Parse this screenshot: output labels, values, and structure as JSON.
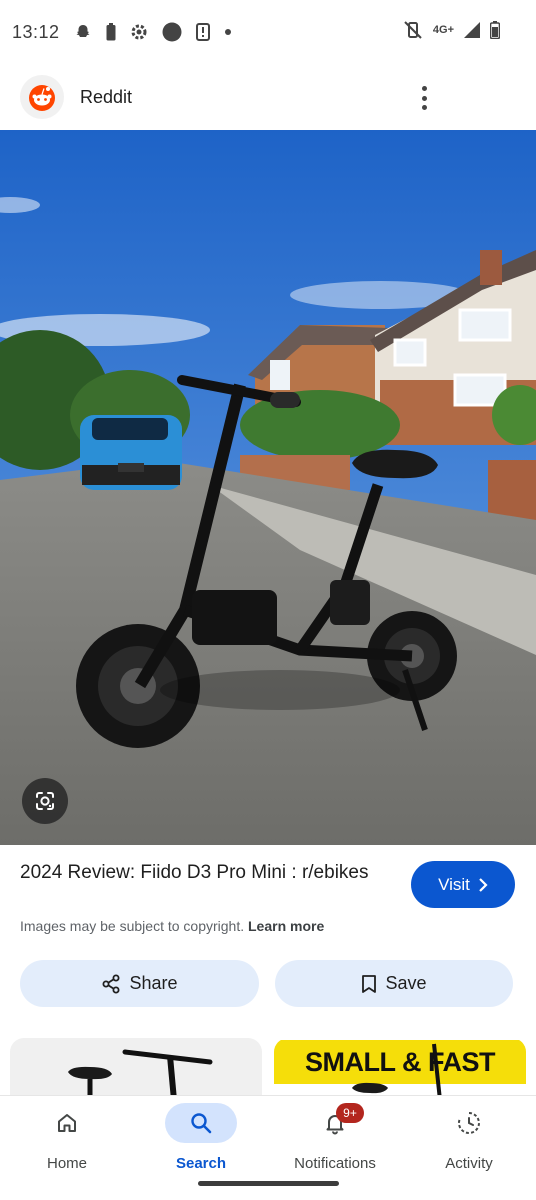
{
  "status_bar": {
    "time": "13:12",
    "network": "4G+",
    "left_icons": [
      "snapchat-icon",
      "battery-saver-icon",
      "settings-icon",
      "circle-icon",
      "sim-alert-icon",
      "dot-icon"
    ],
    "right_icons": [
      "vibrate-off-icon",
      "network-4g-icon",
      "signal-icon",
      "battery-icon"
    ]
  },
  "header": {
    "app_name": "Reddit",
    "logo_icon": "reddit-icon"
  },
  "result": {
    "title": "2024 Review: Fiido D3 Pro Mini : r/ebikes",
    "visit_label": "Visit",
    "copyright_text": "Images may be subject to copyright.",
    "learn_more": "Learn more"
  },
  "actions": {
    "share_label": "Share",
    "save_label": "Save"
  },
  "related": {
    "thumb2_banner": "SMALL & FAST"
  },
  "bottom_nav": {
    "items": [
      {
        "label": "Home",
        "icon": "home-icon",
        "active": false
      },
      {
        "label": "Search",
        "icon": "search-icon",
        "active": true
      },
      {
        "label": "Notifications",
        "icon": "bell-icon",
        "active": false,
        "badge": "9+"
      },
      {
        "label": "Activity",
        "icon": "activity-icon",
        "active": false
      }
    ]
  },
  "colors": {
    "accent": "#0b57d0",
    "chip_bg": "#e3edfb",
    "badge": "#b3261e",
    "banner_yellow": "#f5de0a",
    "reddit_orange": "#ff4500"
  }
}
